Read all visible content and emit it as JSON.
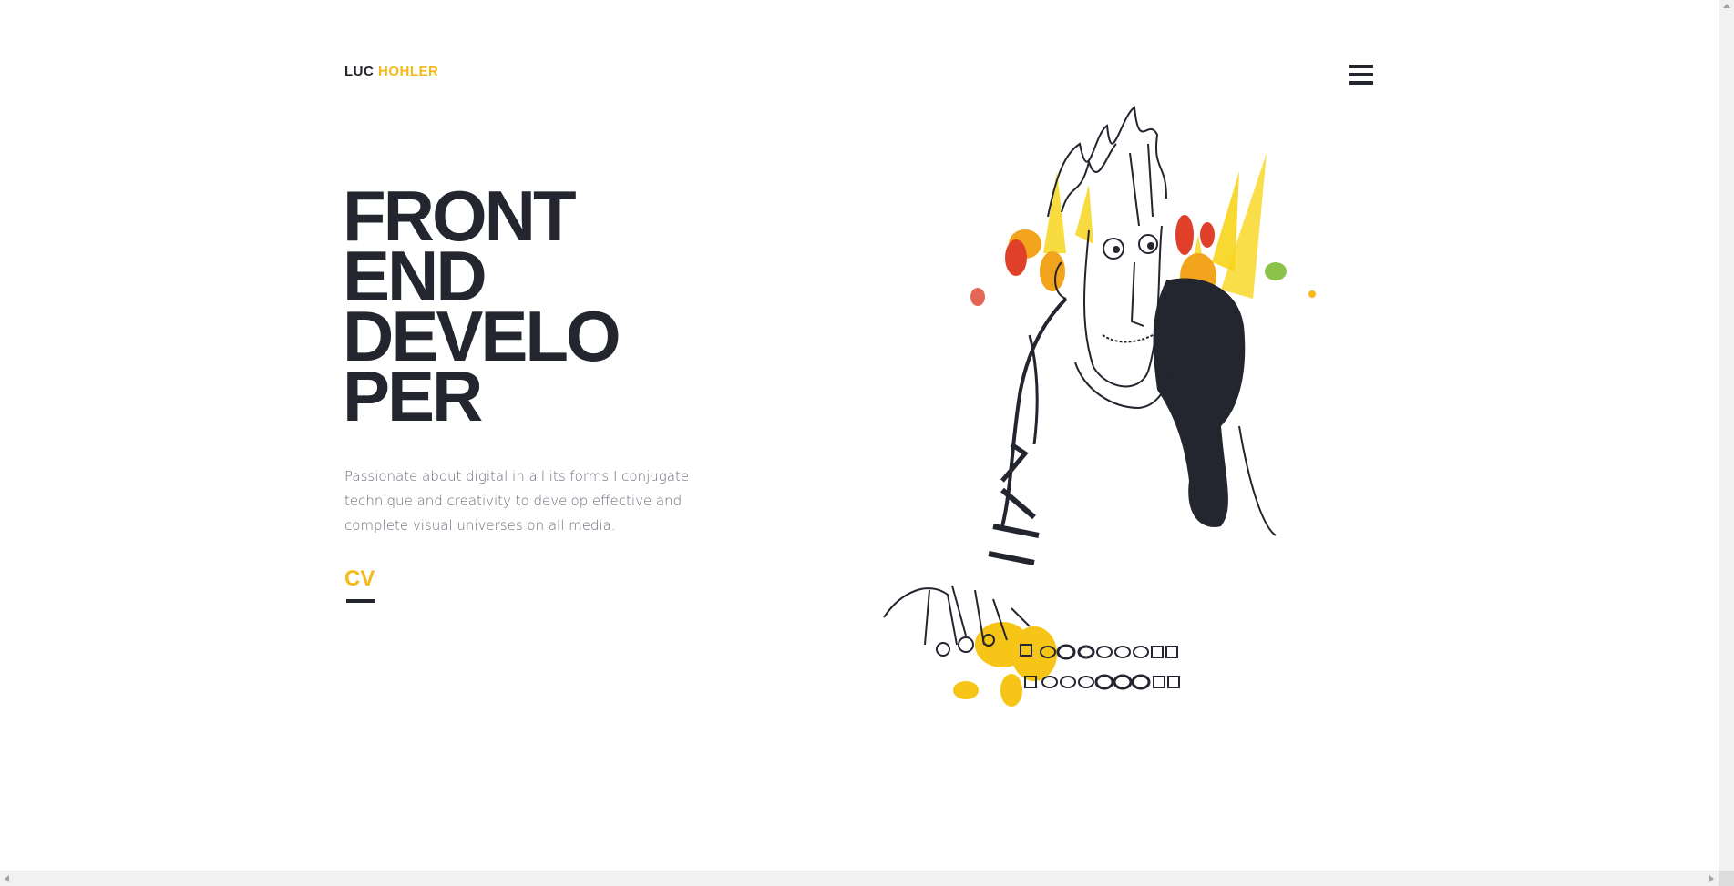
{
  "header": {
    "brand_first": "LUC",
    "brand_last": "HOHLER",
    "menu_icon": "hamburger-menu-icon"
  },
  "hero": {
    "title_lines": [
      "FRONT",
      "END",
      "DEVELO",
      "PER"
    ],
    "intro": "Passionate about digital in all its forms I conjugate technique and creativity to develop effective and complete visual universes on all media.",
    "cv_label": "CV"
  },
  "illustration": {
    "icon": "developer-sketch-illustration"
  },
  "colors": {
    "dark": "#23252f",
    "accent": "#f7b918",
    "text_muted": "#6a6d78",
    "background": "#ffffff"
  }
}
